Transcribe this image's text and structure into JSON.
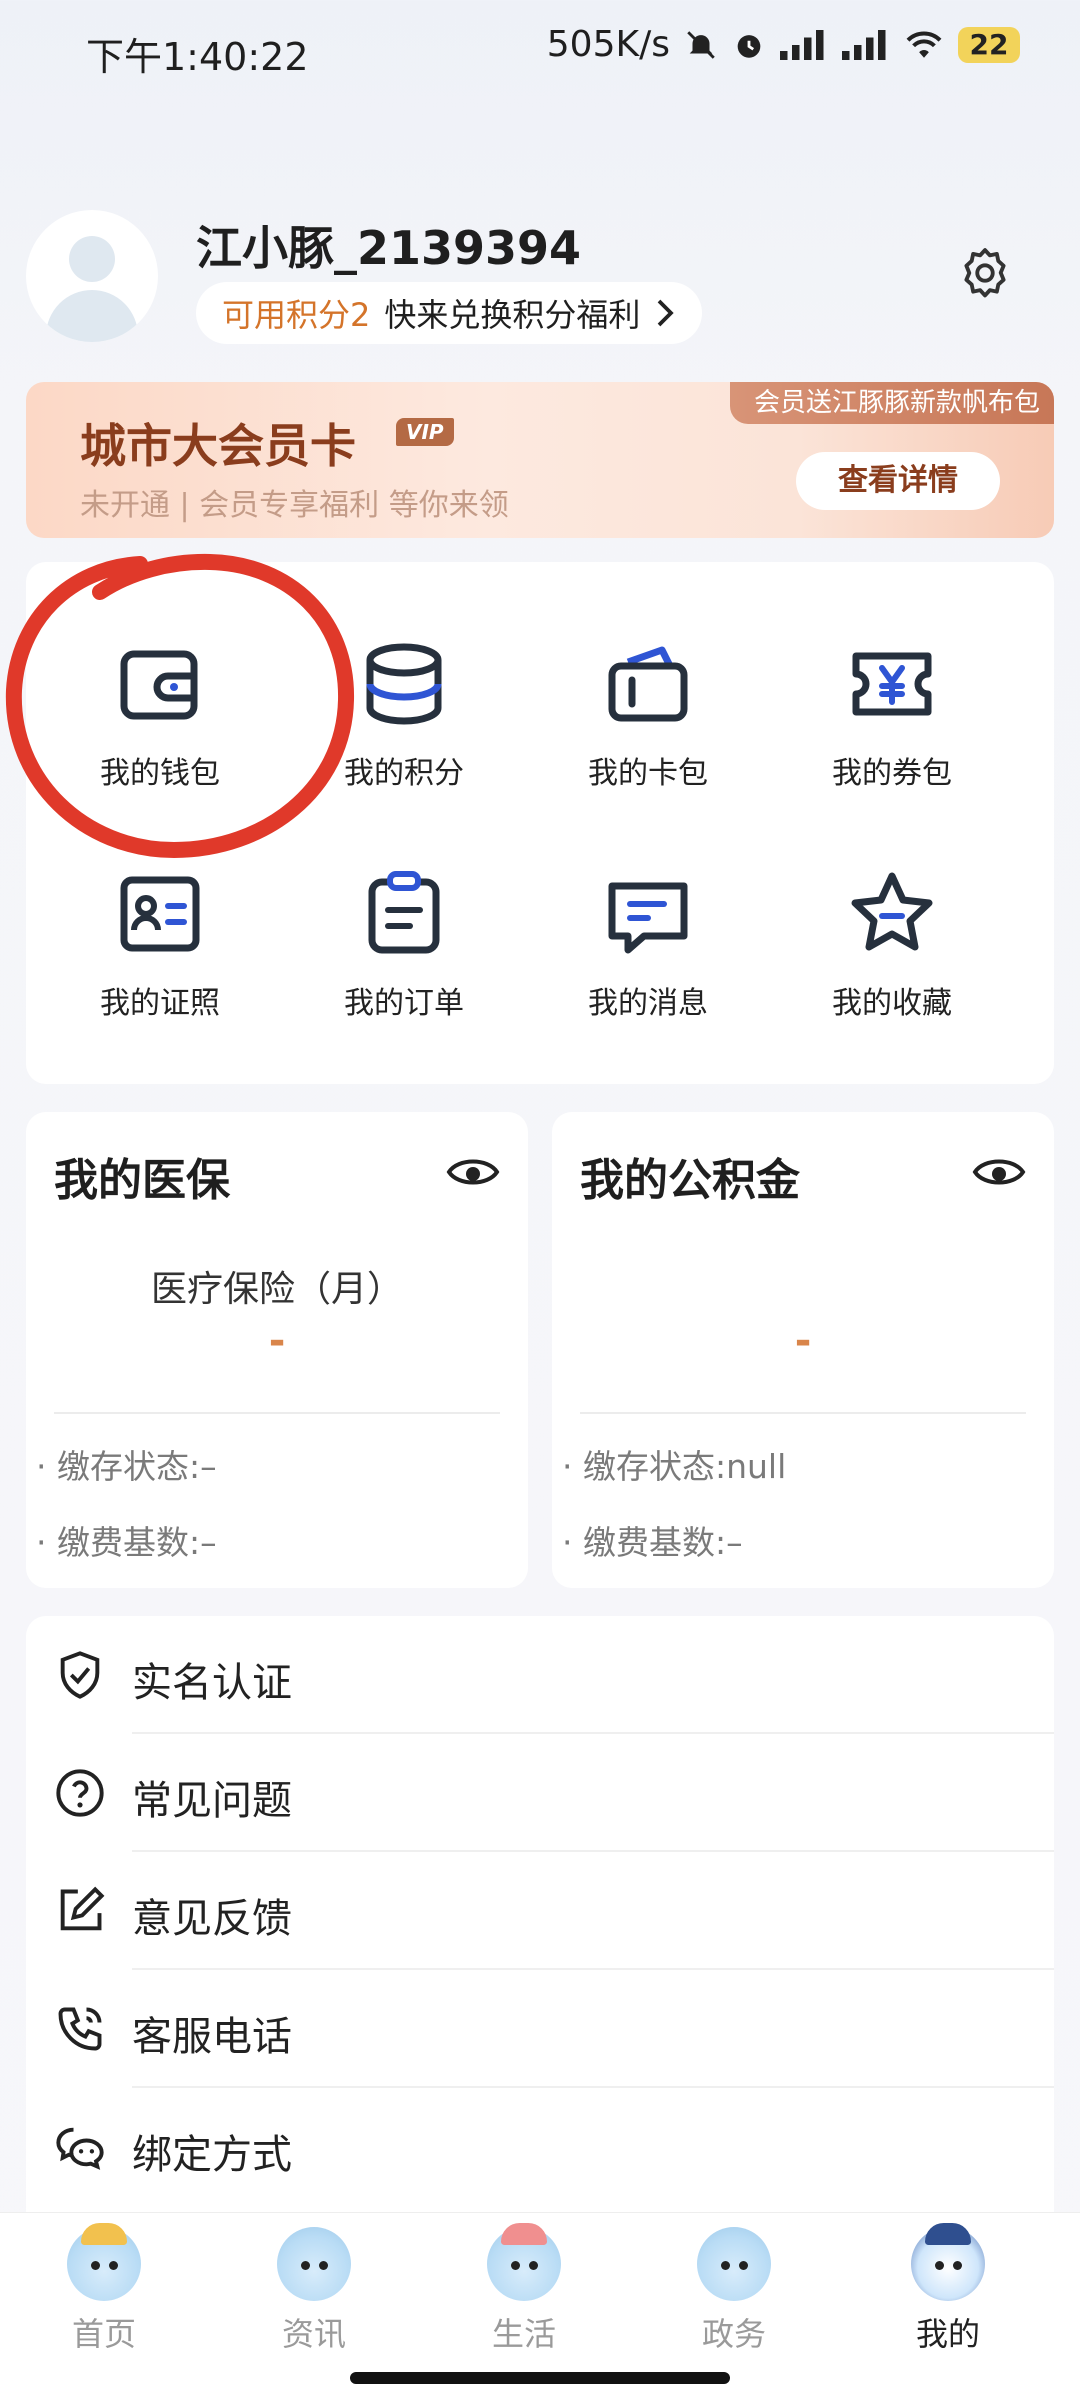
{
  "status_bar": {
    "time": "下午1:40:22",
    "speed": "505K/s",
    "battery": "22"
  },
  "profile": {
    "username": "江小豚_2139394",
    "points_label": "可用积分2",
    "points_cta": "快来兑换积分福利"
  },
  "vip_card": {
    "title": "城市大会员卡",
    "badge": "VIP",
    "subtitle": "未开通 | 会员专享福利 等你来领",
    "button": "查看详情",
    "ribbon": "会员送江豚豚新款帆布包"
  },
  "grid": [
    {
      "label": "我的钱包",
      "icon": "wallet-icon"
    },
    {
      "label": "我的积分",
      "icon": "coins-icon"
    },
    {
      "label": "我的卡包",
      "icon": "card-holder-icon"
    },
    {
      "label": "我的券包",
      "icon": "coupon-icon"
    },
    {
      "label": "我的证照",
      "icon": "id-card-icon"
    },
    {
      "label": "我的订单",
      "icon": "clipboard-icon"
    },
    {
      "label": "我的消息",
      "icon": "message-icon"
    },
    {
      "label": "我的收藏",
      "icon": "star-icon"
    }
  ],
  "medical": {
    "title": "我的医保",
    "subtitle": "医疗保险（月）",
    "value": "-",
    "status_row": "· 缴存状态:–",
    "base_row": "· 缴费基数:–"
  },
  "fund": {
    "title": "我的公积金",
    "value": "-",
    "status_row": "· 缴存状态:null",
    "base_row": "· 缴费基数:–"
  },
  "menu": [
    {
      "label": "实名认证",
      "icon": "shield-check-icon"
    },
    {
      "label": "常见问题",
      "icon": "question-icon"
    },
    {
      "label": "意见反馈",
      "icon": "edit-icon"
    },
    {
      "label": "客服电话",
      "icon": "phone-icon"
    },
    {
      "label": "绑定方式",
      "icon": "wechat-icon"
    }
  ],
  "bottom_nav": [
    {
      "label": "首页",
      "active": false
    },
    {
      "label": "资讯",
      "active": false
    },
    {
      "label": "生活",
      "active": false
    },
    {
      "label": "政务",
      "active": false
    },
    {
      "label": "我的",
      "active": true
    }
  ],
  "colors": {
    "accent_blue": "#2f55d4",
    "icon_dark": "#26303d",
    "points_orange": "#d4742a",
    "vip_brown": "#8a3d1d",
    "annotation_red": "#e0392a"
  }
}
